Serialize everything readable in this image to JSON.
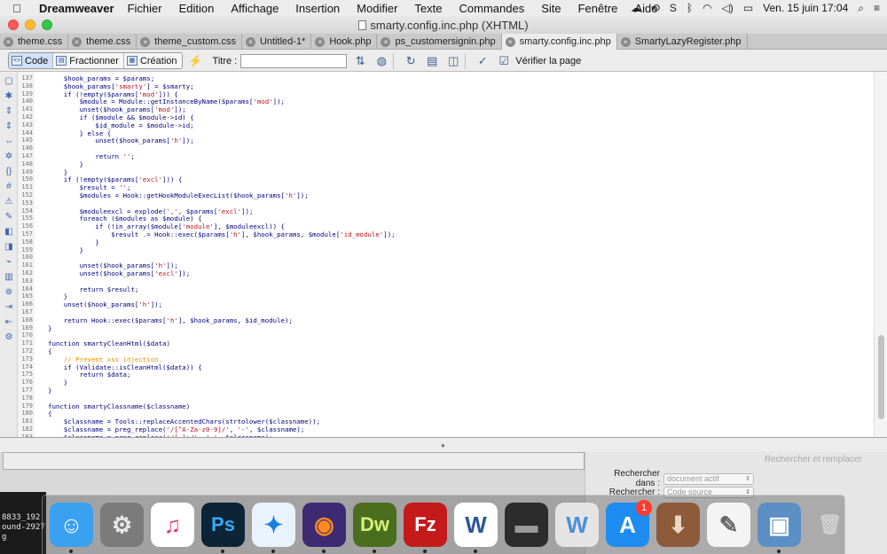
{
  "menubar": {
    "app_name": "Dreamweaver",
    "items": [
      "Fichier",
      "Edition",
      "Affichage",
      "Insertion",
      "Modifier",
      "Texte",
      "Commandes",
      "Site",
      "Fenêtre",
      "Aide"
    ],
    "battery_icon": "battery-icon",
    "datetime": "Ven. 15 juin  17:04"
  },
  "window": {
    "title": "smarty.config.inc.php (XHTML)"
  },
  "tabs": [
    {
      "label": "theme.css",
      "active": false
    },
    {
      "label": "theme.css",
      "active": false
    },
    {
      "label": "theme_custom.css",
      "active": false
    },
    {
      "label": "Untitled-1*",
      "active": false
    },
    {
      "label": "Hook.php",
      "active": false
    },
    {
      "label": "ps_customersignin.php",
      "active": false
    },
    {
      "label": "smarty.config.inc.php",
      "active": true
    },
    {
      "label": "SmartyLazyRegister.php",
      "active": false
    }
  ],
  "toolbar": {
    "code_label": "Code",
    "split_label": "Fractionner",
    "design_label": "Création",
    "title_label": "Titre :",
    "title_value": "",
    "verify_label": "Vérifier la page"
  },
  "editor": {
    "lines": [
      {
        "n": "137",
        "parts": [
          {
            "t": "    $hook_params = $params;"
          }
        ]
      },
      {
        "n": "138",
        "parts": [
          {
            "t": "    $hook_params["
          },
          {
            "t": "'smarty'",
            "c": "str"
          },
          {
            "t": "] = $smarty;"
          }
        ]
      },
      {
        "n": "139",
        "parts": [
          {
            "t": "    if (!empty($params["
          },
          {
            "t": "'mod'",
            "c": "str"
          },
          {
            "t": "])) {"
          }
        ]
      },
      {
        "n": "140",
        "parts": [
          {
            "t": "        $module = Module::getInstanceByName($params["
          },
          {
            "t": "'mod'",
            "c": "str"
          },
          {
            "t": "]);"
          }
        ]
      },
      {
        "n": "141",
        "parts": [
          {
            "t": "        unset($hook_params["
          },
          {
            "t": "'mod'",
            "c": "str"
          },
          {
            "t": "]);"
          }
        ]
      },
      {
        "n": "142",
        "parts": [
          {
            "t": "        if ($module && $module->id) {"
          }
        ]
      },
      {
        "n": "143",
        "parts": [
          {
            "t": "            $id_module = $module->id;"
          }
        ]
      },
      {
        "n": "144",
        "parts": [
          {
            "t": "        } else {"
          }
        ]
      },
      {
        "n": "145",
        "parts": [
          {
            "t": "            unset($hook_params["
          },
          {
            "t": "'h'",
            "c": "str"
          },
          {
            "t": "]);"
          }
        ]
      },
      {
        "n": "146",
        "parts": [
          {
            "t": ""
          }
        ]
      },
      {
        "n": "147",
        "parts": [
          {
            "t": "            return "
          },
          {
            "t": "''",
            "c": "str"
          },
          {
            "t": ";"
          }
        ]
      },
      {
        "n": "148",
        "parts": [
          {
            "t": "        }"
          }
        ]
      },
      {
        "n": "149",
        "parts": [
          {
            "t": "    }"
          }
        ]
      },
      {
        "n": "150",
        "parts": [
          {
            "t": "    if (!empty($params["
          },
          {
            "t": "'excl'",
            "c": "str"
          },
          {
            "t": "])) {"
          }
        ]
      },
      {
        "n": "151",
        "parts": [
          {
            "t": "        $result = "
          },
          {
            "t": "''",
            "c": "str"
          },
          {
            "t": ";"
          }
        ]
      },
      {
        "n": "152",
        "parts": [
          {
            "t": "        $modules = Hook::getHookModuleExecList($hook_params["
          },
          {
            "t": "'h'",
            "c": "str"
          },
          {
            "t": "]);"
          }
        ]
      },
      {
        "n": "153",
        "parts": [
          {
            "t": ""
          }
        ]
      },
      {
        "n": "154",
        "parts": [
          {
            "t": "        $moduleexcl = explode("
          },
          {
            "t": "','",
            "c": "str"
          },
          {
            "t": ", $params["
          },
          {
            "t": "'excl'",
            "c": "str"
          },
          {
            "t": "]);"
          }
        ]
      },
      {
        "n": "155",
        "parts": [
          {
            "t": "        foreach ($modules as $module) {"
          }
        ]
      },
      {
        "n": "156",
        "parts": [
          {
            "t": "            if (!in_array($module["
          },
          {
            "t": "'module'",
            "c": "str"
          },
          {
            "t": "], $moduleexcl)) {"
          }
        ]
      },
      {
        "n": "157",
        "parts": [
          {
            "t": "                $result .= Hook::exec($params["
          },
          {
            "t": "'h'",
            "c": "str"
          },
          {
            "t": "], $hook_params, $module["
          },
          {
            "t": "'id_module'",
            "c": "str"
          },
          {
            "t": "]);"
          }
        ]
      },
      {
        "n": "158",
        "parts": [
          {
            "t": "            }"
          }
        ]
      },
      {
        "n": "159",
        "parts": [
          {
            "t": "        }"
          }
        ]
      },
      {
        "n": "160",
        "parts": [
          {
            "t": ""
          }
        ]
      },
      {
        "n": "161",
        "parts": [
          {
            "t": "        unset($hook_params["
          },
          {
            "t": "'h'",
            "c": "str"
          },
          {
            "t": "]);"
          }
        ]
      },
      {
        "n": "162",
        "parts": [
          {
            "t": "        unset($hook_params["
          },
          {
            "t": "'excl'",
            "c": "str"
          },
          {
            "t": "]);"
          }
        ]
      },
      {
        "n": "163",
        "parts": [
          {
            "t": ""
          }
        ]
      },
      {
        "n": "164",
        "parts": [
          {
            "t": "        return $result;"
          }
        ]
      },
      {
        "n": "165",
        "parts": [
          {
            "t": "    }"
          }
        ]
      },
      {
        "n": "166",
        "parts": [
          {
            "t": "    unset($hook_params["
          },
          {
            "t": "'h'",
            "c": "str"
          },
          {
            "t": "]);"
          }
        ]
      },
      {
        "n": "167",
        "parts": [
          {
            "t": ""
          }
        ]
      },
      {
        "n": "168",
        "parts": [
          {
            "t": "    return Hook::exec($params["
          },
          {
            "t": "'h'",
            "c": "str"
          },
          {
            "t": "], $hook_params, $id_module);"
          }
        ]
      },
      {
        "n": "169",
        "parts": [
          {
            "t": "}"
          }
        ]
      },
      {
        "n": "170",
        "parts": [
          {
            "t": ""
          }
        ]
      },
      {
        "n": "171",
        "parts": [
          {
            "t": "function smartyCleanHtml($data)"
          }
        ]
      },
      {
        "n": "172",
        "parts": [
          {
            "t": "{"
          }
        ]
      },
      {
        "n": "173",
        "parts": [
          {
            "t": "    "
          },
          {
            "t": "// Prevent xss injection.",
            "c": "cmt"
          }
        ]
      },
      {
        "n": "174",
        "parts": [
          {
            "t": "    if (Validate::isCleanHtml($data)) {"
          }
        ]
      },
      {
        "n": "175",
        "parts": [
          {
            "t": "        return $data;"
          }
        ]
      },
      {
        "n": "176",
        "parts": [
          {
            "t": "    }"
          }
        ]
      },
      {
        "n": "177",
        "parts": [
          {
            "t": "}"
          }
        ]
      },
      {
        "n": "178",
        "parts": [
          {
            "t": ""
          }
        ]
      },
      {
        "n": "179",
        "parts": [
          {
            "t": "function smartyClassname($classname)"
          }
        ]
      },
      {
        "n": "180",
        "parts": [
          {
            "t": "{"
          }
        ]
      },
      {
        "n": "181",
        "parts": [
          {
            "t": "    $classname = Tools::replaceAccentedChars(strtolower($classname));"
          }
        ]
      },
      {
        "n": "182",
        "parts": [
          {
            "t": "    $classname = preg_replace("
          },
          {
            "t": "'/[^A-Za-z0-9]/'",
            "c": "str"
          },
          {
            "t": ", "
          },
          {
            "t": "'-'",
            "c": "str"
          },
          {
            "t": ", $classname);"
          }
        ]
      },
      {
        "n": "183",
        "parts": [
          {
            "t": "    $classname = preg_replace("
          },
          {
            "t": "'/[-]+/'",
            "c": "str"
          },
          {
            "t": ", "
          },
          {
            "t": "'-'",
            "c": "str"
          },
          {
            "t": ", $classname);"
          }
        ]
      }
    ]
  },
  "search_panel": {
    "title": "Rechercher et remplacer",
    "search_in_label": "Rechercher dans :",
    "search_in_value": "document actif",
    "search_label": "Rechercher :",
    "search_value": "Code source"
  },
  "terminal": {
    "lines": [
      "8833_192",
      "ound-2927",
      "g"
    ]
  },
  "dock": {
    "apps": [
      {
        "name": "finder-icon",
        "glyph": "☺",
        "bg": "#3aa0f0",
        "fg": "#ffffff",
        "running": true
      },
      {
        "name": "system-preferences-icon",
        "glyph": "⚙",
        "bg": "#7b7b7b",
        "fg": "#e8e8e8",
        "running": false
      },
      {
        "name": "itunes-icon",
        "glyph": "♫",
        "bg": "#ffffff",
        "fg": "#e23a6d",
        "running": false
      },
      {
        "name": "photoshop-icon",
        "glyph": "Ps",
        "bg": "#0d2437",
        "fg": "#32a9f5",
        "running": true
      },
      {
        "name": "safari-icon",
        "glyph": "✦",
        "bg": "#e8f3ff",
        "fg": "#1a7fe0",
        "running": true
      },
      {
        "name": "firefox-icon",
        "glyph": "◉",
        "bg": "#3d2a73",
        "fg": "#ff8a1f",
        "running": true
      },
      {
        "name": "dreamweaver-icon",
        "glyph": "Dw",
        "bg": "#4a6d1e",
        "fg": "#d5f27a",
        "running": true
      },
      {
        "name": "filezilla-icon",
        "glyph": "Fz",
        "bg": "#c41a1a",
        "fg": "#ffffff",
        "running": true
      },
      {
        "name": "word-icon",
        "glyph": "W",
        "bg": "#ffffff",
        "fg": "#2b579a",
        "running": true
      },
      {
        "name": "printer-icon",
        "glyph": "▬",
        "bg": "#2c2c2c",
        "fg": "#9a9a9a",
        "running": false
      },
      {
        "name": "wunderlist-icon",
        "glyph": "W",
        "bg": "#e4e4e4",
        "fg": "#4b8fd6",
        "running": false
      },
      {
        "name": "app-store-icon",
        "glyph": "A",
        "bg": "#1e8cf0",
        "fg": "#ffffff",
        "running": false,
        "badge": "1"
      },
      {
        "name": "macos-installer-icon",
        "glyph": "⬇",
        "bg": "#8d5a3a",
        "fg": "#e9d6c3",
        "running": false
      },
      {
        "name": "textedit-icon",
        "glyph": "✎",
        "bg": "#f4f4f4",
        "fg": "#666666",
        "running": false
      },
      {
        "name": "preview-icon",
        "glyph": "▣",
        "bg": "#5c8fc4",
        "fg": "#ffffff",
        "running": true
      },
      {
        "name": "trash-icon",
        "glyph": "🗑",
        "bg": "transparent",
        "fg": "#cfcfcf",
        "running": false
      }
    ]
  }
}
